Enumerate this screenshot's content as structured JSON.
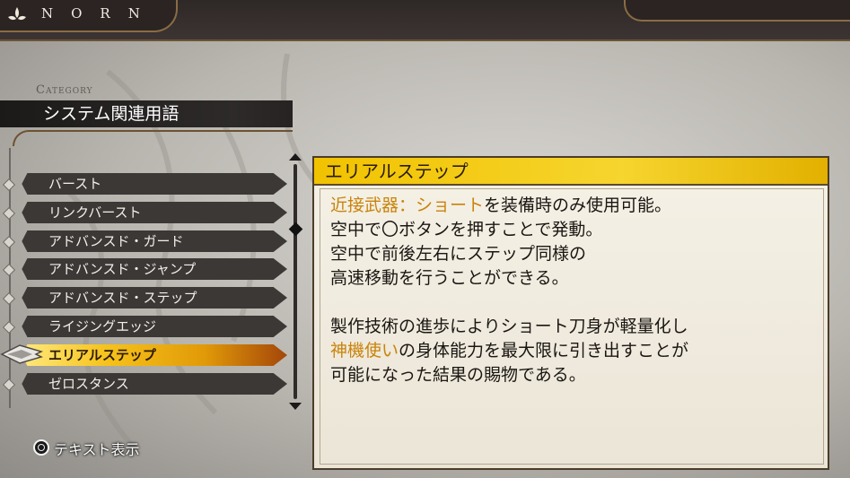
{
  "header": {
    "logo_text": "NORN"
  },
  "category": {
    "caption": "Category",
    "name": "システム関連用語"
  },
  "list": {
    "items": [
      {
        "label": "バースト"
      },
      {
        "label": "リンクバースト"
      },
      {
        "label": "アドバンスド・ガード"
      },
      {
        "label": "アドバンスド・ジャンプ"
      },
      {
        "label": "アドバンスド・ステップ"
      },
      {
        "label": "ライジングエッジ"
      },
      {
        "label": "エリアルステップ"
      },
      {
        "label": "ゼロスタンス"
      }
    ],
    "selected_index": 6
  },
  "detail": {
    "title": "エリアルステップ",
    "line1_highlight": "近接武器：ショート",
    "line1_rest": "を装備時のみ使用可能。",
    "line2": "空中で〇ボタンを押すことで発動。",
    "line3": "空中で前後左右にステップ同様の",
    "line4": "高速移動を行うことができる。",
    "line5": "製作技術の進歩によりショート刀身が軽量化し",
    "line6_highlight": "神機使い",
    "line6_rest": "の身体能力を最大限に引き出すことが",
    "line7": "可能になった結果の賜物である。"
  },
  "footer": {
    "button_icon": "circle-button-icon",
    "label": "テキスト表示"
  },
  "colors": {
    "highlight": "#c9830a",
    "title_bar": "#f1c200",
    "accent_frame": "#6d5231"
  }
}
